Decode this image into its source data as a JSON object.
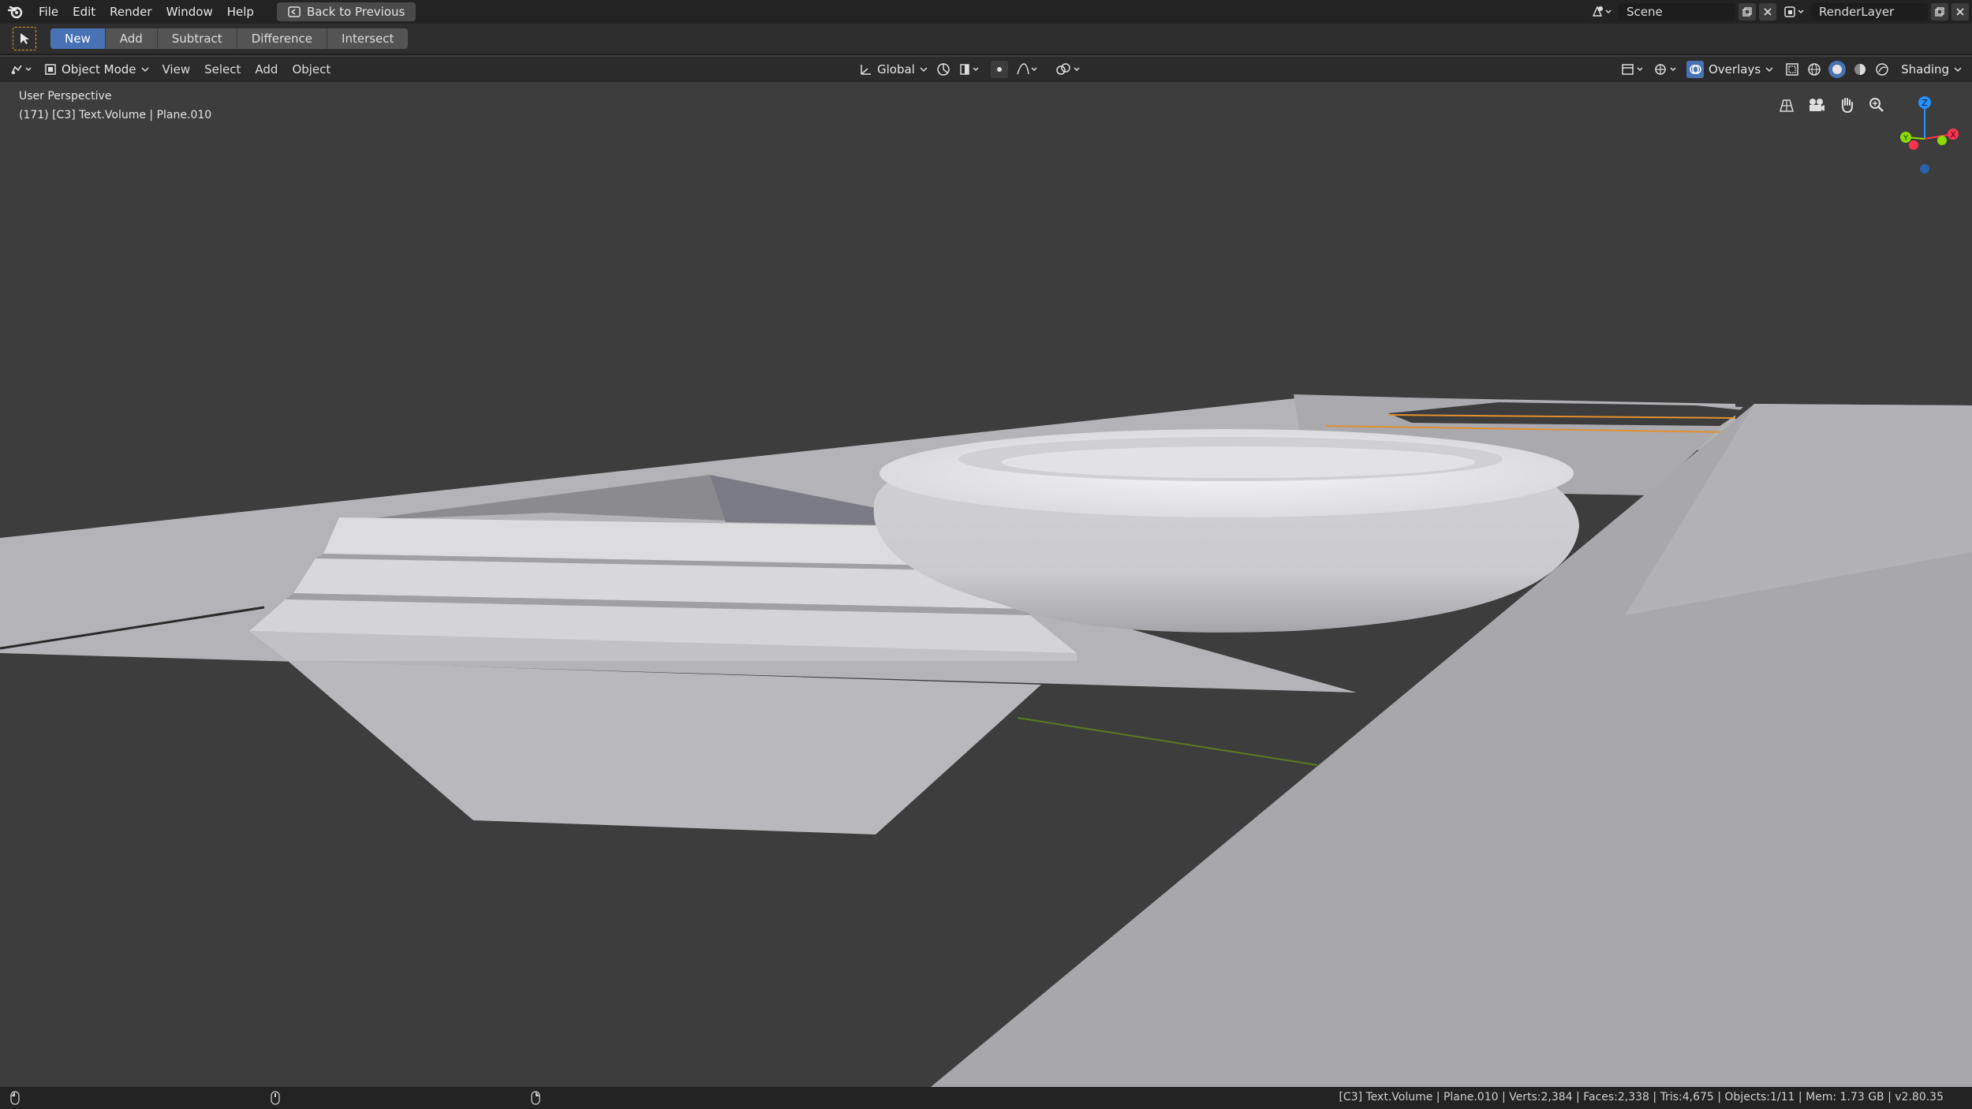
{
  "topbar": {
    "menus": [
      "File",
      "Edit",
      "Render",
      "Window",
      "Help"
    ],
    "back_button": "Back to Previous",
    "scene_name": "Scene",
    "render_layer": "RenderLayer"
  },
  "tool_header": {
    "tabs": [
      "New",
      "Add",
      "Subtract",
      "Difference",
      "Intersect"
    ],
    "active_tab": "New"
  },
  "view_header": {
    "mode": "Object Mode",
    "menus": [
      "View",
      "Select",
      "Add",
      "Object"
    ],
    "orientation": "Global",
    "overlays_label": "Overlays",
    "shading_label": "Shading"
  },
  "viewport": {
    "perspective_label": "User Perspective",
    "object_info": "(171) [C3] Text.Volume | Plane.010",
    "gizmo_axes": [
      "Z",
      "Y",
      "X"
    ],
    "colors": {
      "background": "#3d3d3d",
      "accent": "#4772b3",
      "axis_x": "#ff3352",
      "axis_y": "#8bdc00",
      "axis_z": "#2890ff"
    }
  },
  "statusbar": {
    "info": "[C3] Text.Volume | Plane.010 | Verts:2,384 | Faces:2,338 | Tris:4,675 | Objects:1/11 | Mem: 1.73 GB | v2.80.35"
  }
}
